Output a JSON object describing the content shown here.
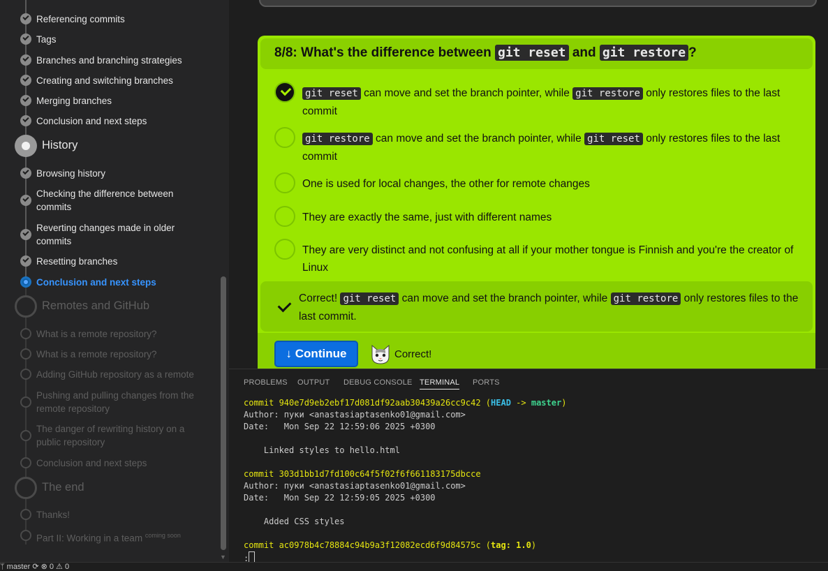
{
  "sidebar": {
    "items_top": [
      {
        "label": "Referencing commits"
      },
      {
        "label": "Tags"
      },
      {
        "label": "Branches and branching strategies"
      },
      {
        "label": "Creating and switching branches"
      },
      {
        "label": "Merging branches"
      },
      {
        "label": "Conclusion and next steps"
      }
    ],
    "section_history": "History",
    "history_items": [
      {
        "label": "Browsing history"
      },
      {
        "label": "Checking the difference between commits"
      },
      {
        "label": "Reverting changes made in older commits"
      },
      {
        "label": "Resetting branches"
      },
      {
        "label": "Conclusion and next steps"
      }
    ],
    "section_remotes": "Remotes and GitHub",
    "remote_items": [
      {
        "label": "What is a remote repository?"
      },
      {
        "label": "What is a remote repository?"
      },
      {
        "label": "Adding GitHub repository as a remote"
      },
      {
        "label": "Pushing and pulling changes from the remote repository"
      },
      {
        "label": "The danger of rewriting history on a public repository"
      },
      {
        "label": "Conclusion and next steps"
      }
    ],
    "section_end": "The end",
    "end_items": [
      {
        "label": "Thanks!"
      },
      {
        "label": "Part II: Working in a team",
        "badge": "coming soon"
      }
    ]
  },
  "status_bar": {
    "text": "ᛘ master ⟳  ⊗ 0 ⚠ 0"
  },
  "quiz": {
    "title_prefix": "8/8: What's the difference between",
    "cmd_reset": "git reset",
    "title_and": "and",
    "cmd_restore": "git restore",
    "title_suffix": "?",
    "options": [
      {
        "text_1": "can move and set the branch pointer, while",
        "text_2": "only restores files to the last commit",
        "selected": true
      },
      {
        "text_1": "can move and set the branch pointer, while",
        "text_2": "only restores files to the last commit",
        "selected": false
      },
      {
        "text": "One is used for local changes, the other for remote changes",
        "selected": false
      },
      {
        "text": "They are exactly the same, just with different names",
        "selected": false
      },
      {
        "text": "They are very distinct and not confusing at all if your mother tongue is Finnish and you're the creator of Linux",
        "selected": false
      }
    ],
    "feedback": {
      "prefix": "Correct!",
      "text_1": "can move and set the branch pointer, while",
      "text_2": "only restores files to the last commit."
    },
    "continue_label": "↓ Continue",
    "continue_status": "Correct!"
  },
  "panel": {
    "tabs": [
      "PROBLEMS",
      "OUTPUT",
      "DEBUG CONSOLE",
      "TERMINAL",
      "PORTS"
    ],
    "active_tab": "TERMINAL",
    "commits": [
      {
        "hash": "commit 940e7d9eb2ebf17d081df92aab30439a26cc9c42",
        "head": "HEAD",
        "arrow": "->",
        "branch": "master",
        "author": "Author: пуки <anastasiaptasenko01@gmail.com>",
        "date": "Date:   Mon Sep 22 12:59:06 2025 +0300",
        "message": "Linked styles to hello.html"
      },
      {
        "hash": "commit 303d1bb1d7fd100c64f5f02f6f661183175dbcce",
        "author": "Author: пуки <anastasiaptasenko01@gmail.com>",
        "date": "Date:   Mon Sep 22 12:59:05 2025 +0300",
        "message": "Added CSS styles"
      },
      {
        "hash": "commit ac0978b4c78884c94b9a3f12082ecd6f9d84575c",
        "tag": "tag: 1.0"
      }
    ],
    "prompt": ":"
  },
  "colors": {
    "quiz_bg": "#9ae600",
    "quiz_header": "#8ad100",
    "continue_button": "#0c6ee0",
    "active_link": "#3794ff",
    "commit_hash": "#e5e510",
    "head_label": "#3bc0e8",
    "branch_label": "#3ed38e"
  },
  "icons": [
    "check-circle-icon",
    "radio-empty-icon",
    "check-icon",
    "cat-emoji-icon",
    "down-arrow-icon"
  ]
}
